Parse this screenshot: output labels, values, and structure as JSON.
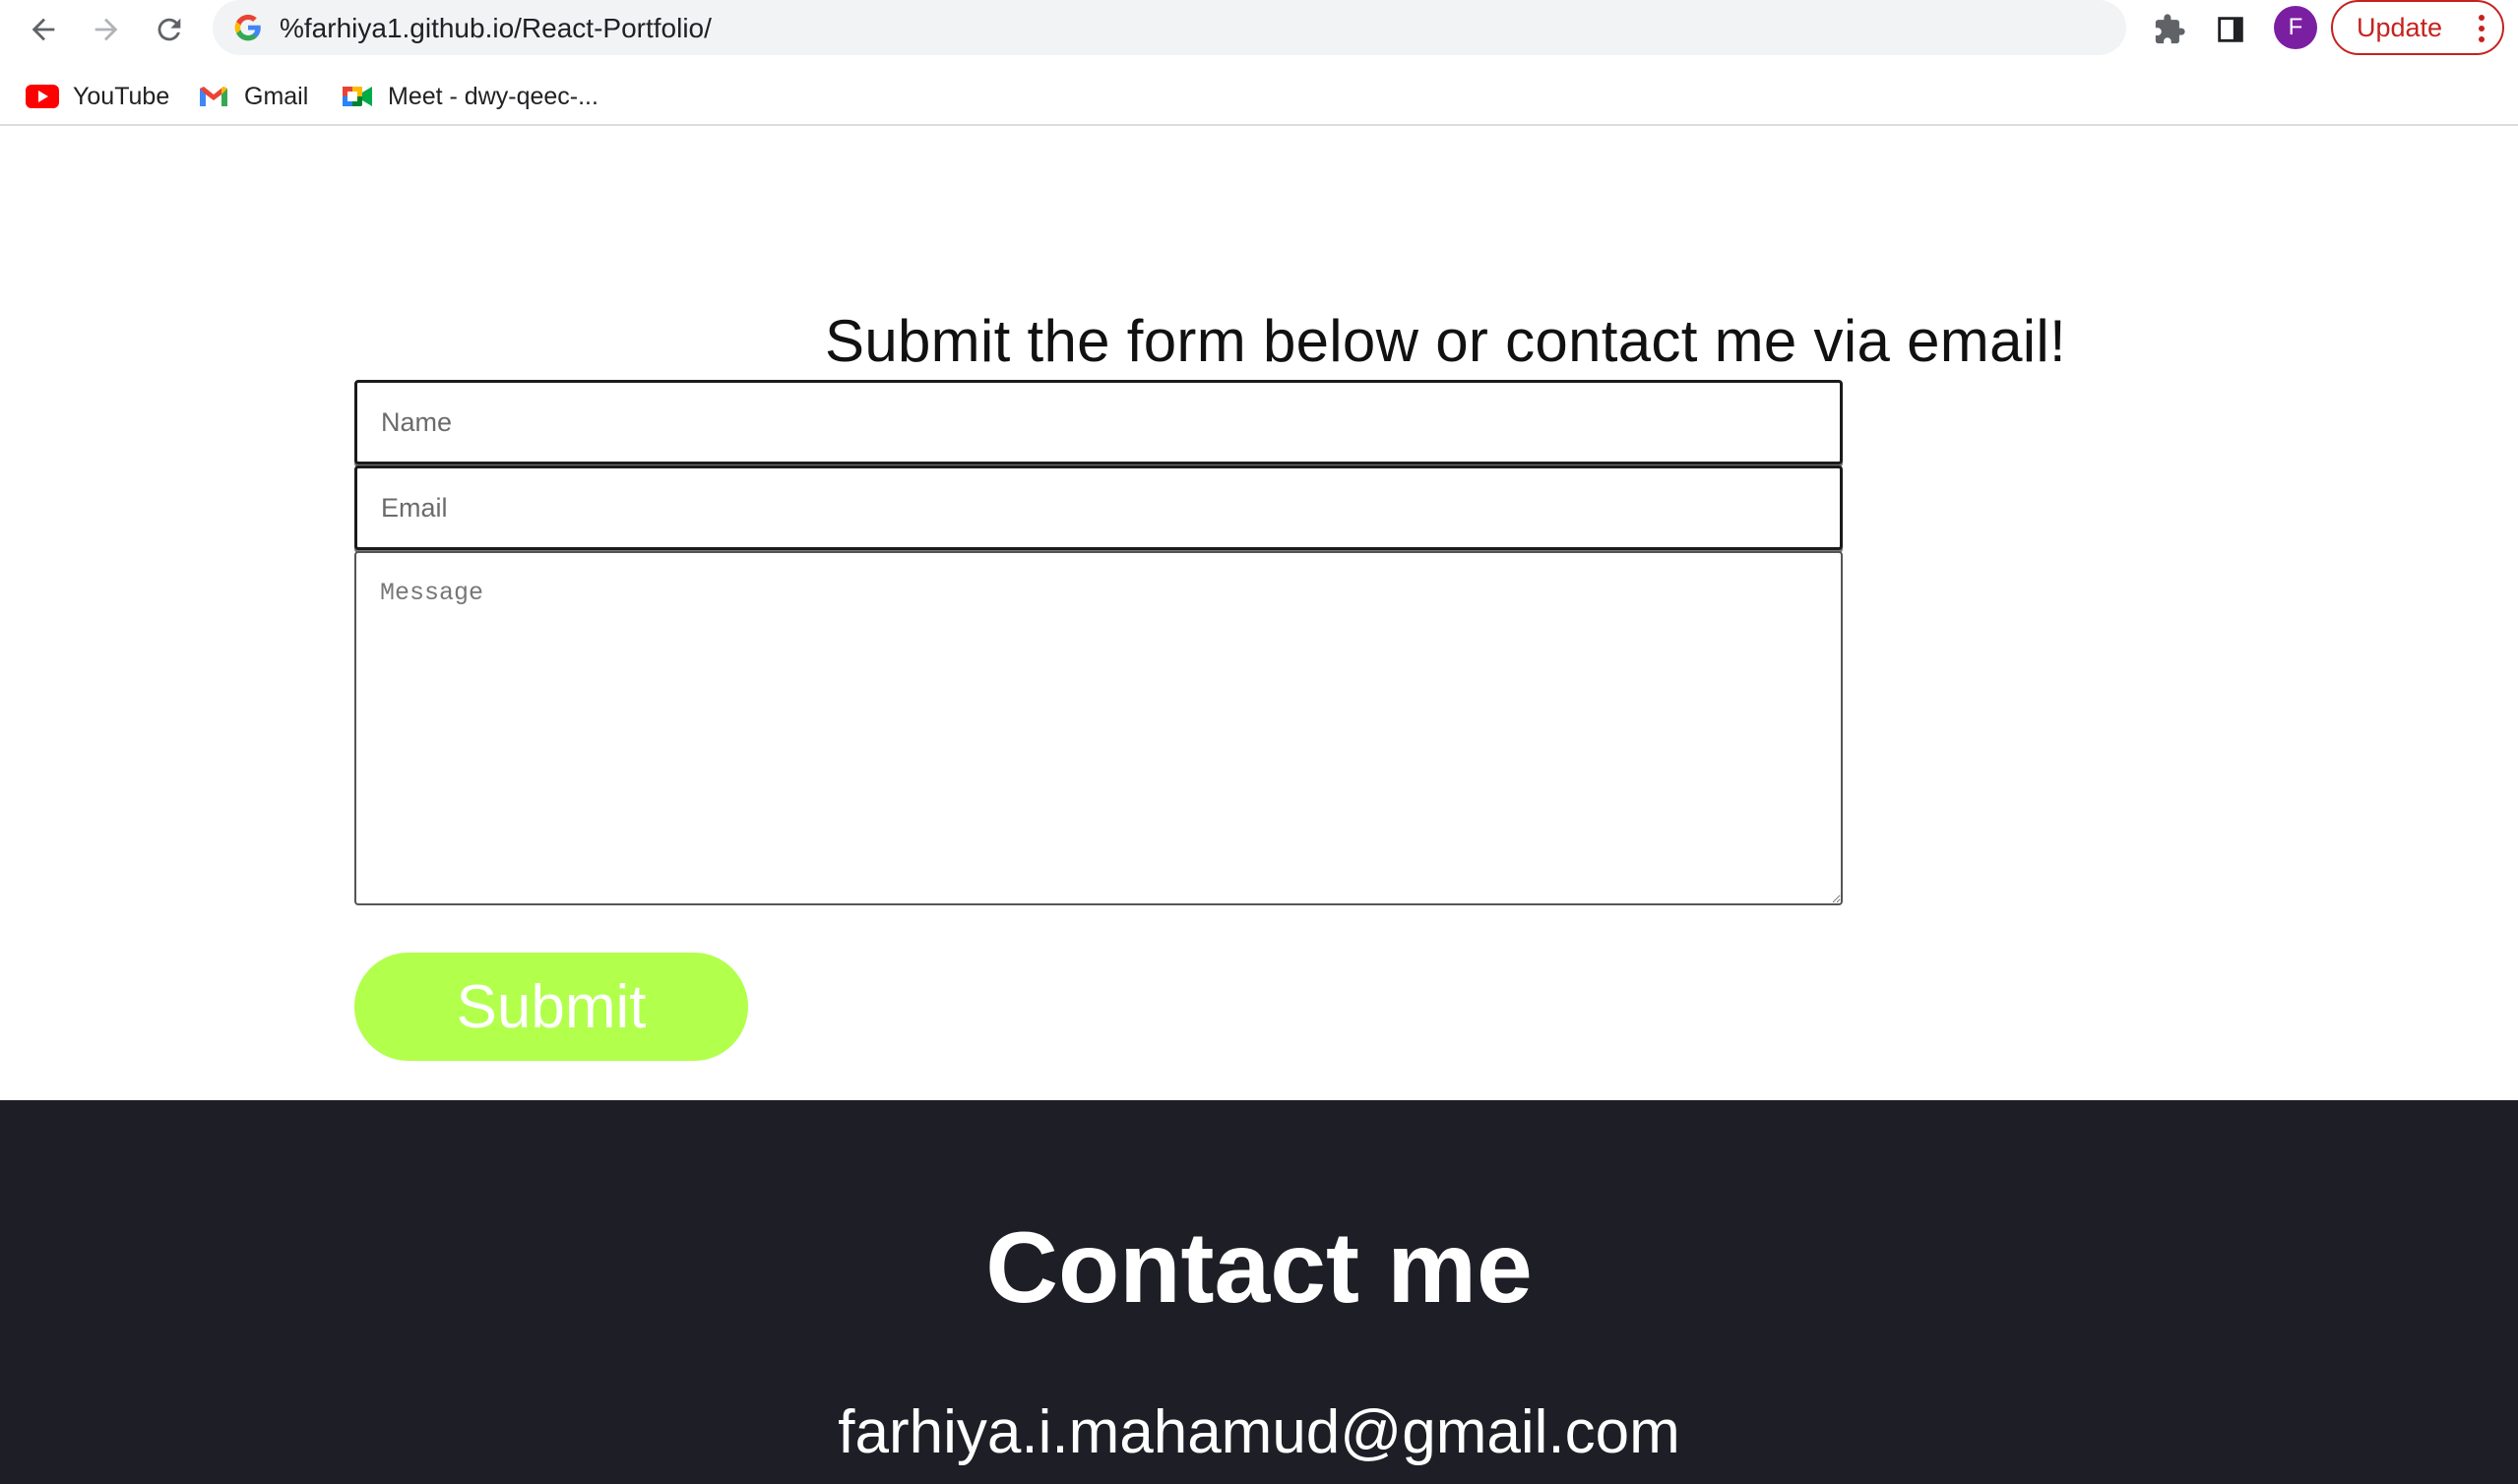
{
  "browser": {
    "url": "%farhiya1.github.io/React-Portfolio/",
    "profile_initial": "F",
    "update_label": "Update",
    "bookmarks": [
      {
        "label": "YouTube",
        "icon": "youtube-icon"
      },
      {
        "label": "Gmail",
        "icon": "gmail-icon"
      },
      {
        "label": "Meet - dwy-qeec-...",
        "icon": "meet-icon"
      }
    ]
  },
  "contact_form": {
    "heading": "Submit the form below or contact me via email!",
    "name_placeholder": "Name",
    "email_placeholder": "Email",
    "message_placeholder": "Message",
    "submit_label": "Submit"
  },
  "footer": {
    "title": "Contact me",
    "email": "farhiya.i.mahamud@gmail.com"
  },
  "colors": {
    "submit_button": "#b2ff4c",
    "footer_background": "#1e1e26",
    "update_accent": "#c5221f",
    "avatar": "#7b1fa2"
  }
}
